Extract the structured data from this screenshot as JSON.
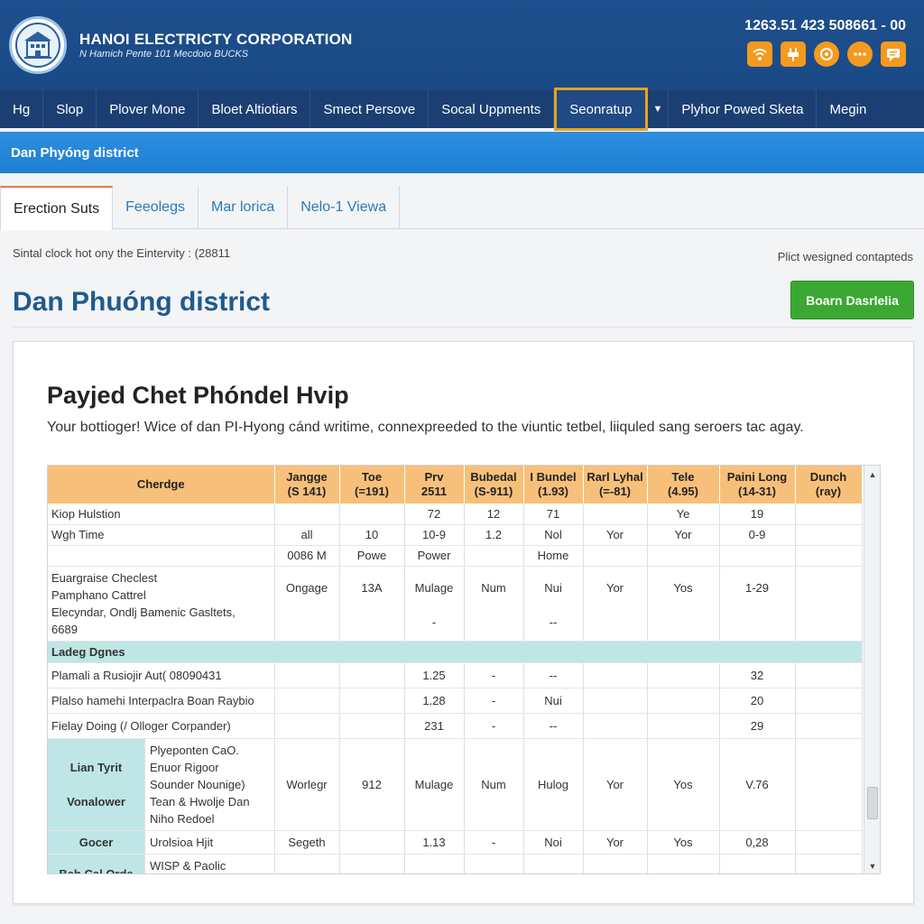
{
  "header": {
    "title": "HANOI ELECTRICTY CORPORATION",
    "subtitle": "N Hamich Pente 101 Mecdoio BUCKS",
    "phone": "1263.51 423 508661 - 00",
    "icons": [
      "wifi-icon",
      "plug-icon",
      "chat-icon",
      "more-icon",
      "message-icon"
    ]
  },
  "nav": {
    "items": [
      "Hg",
      "Slop",
      "Plover Mone",
      "Bloet Altiotiars",
      "Smect Persove",
      "Socal Uppments",
      "Seonratup",
      "Plyhor Powed Sketa",
      "Megin"
    ],
    "active_index": 6
  },
  "banner": {
    "title": "Dan Phyóng district"
  },
  "tabs": [
    "Erection Suts",
    "Feeolegs",
    "Mar lorica",
    "Nelo-1 Viewa"
  ],
  "page": {
    "subline": "Sintal clock hot ony the Eintervity : (28811",
    "subright": "Plict wesigned contapteds",
    "title": "Dan Phuóng district",
    "button_label": "Boarn Dasrlelia"
  },
  "card": {
    "title": "Payjed Chet Phóndel Hvip",
    "description": "Your bottioger! Wice of dan PI-Hyong cánd writime, connexpreeded to the viuntic tetbel, liiquled sang seroers tac agay."
  },
  "table": {
    "headers": [
      "Cherdge",
      "Jangge\n(S 141)",
      "Toe\n(=191)",
      "Prv\n2511",
      "Bubedal\n(S-911)",
      "I Bundel\n(1.93)",
      "Rarl Lyhal\n(=-81)",
      "Tele\n(4.95)",
      "Paini Long\n(14-31)",
      "Dunch\n(ray)"
    ],
    "rows1": [
      [
        "Kiop Hulstion",
        "",
        "",
        "72",
        "12",
        "71",
        "",
        "Ye",
        "19",
        ""
      ],
      [
        "Wgh Time",
        "all",
        "10",
        "10-9",
        "1.2",
        "Nol",
        "Yor",
        "Yor",
        "0-9",
        ""
      ],
      [
        "",
        "0086 M",
        "Powe",
        "Power",
        "",
        "Home",
        "",
        "",
        "",
        ""
      ]
    ],
    "multi_row": {
      "label": "Euargraise Checlest\nPamphano Cattrel\nElecyndar, Ondlj Bamenic Gasltets,\n6689",
      "cells": [
        "Ongage",
        "13A",
        "Mulage\n\n-",
        "Num",
        "Nui\n\n--",
        "Yor",
        "Yos",
        "1-29",
        ""
      ]
    },
    "section_label": "Ladeg Dgnes",
    "rows2": [
      [
        "Plamali a Rusiojir Aut( 08090431",
        "",
        "",
        "1.25",
        "-",
        "--",
        "",
        "",
        "32",
        ""
      ],
      [
        "Plalso hamehi Interpaclra Boan Raybio",
        "",
        "",
        "1.28",
        "-",
        "Nui",
        "",
        "",
        "20",
        ""
      ],
      [
        "Fielay Doing (/ Olloger Corpander)",
        "",
        "",
        "231",
        "-",
        "--",
        "",
        "",
        "29",
        ""
      ]
    ],
    "group_row": {
      "group": "Lian Tyrit\n\nVonalower",
      "label": "Plyeponten CaO.\nEnuor Rigoor\nSounder Nounige)\nTean & Hwolje Dan\nNiho Redoel",
      "cells": [
        "Worlegr",
        "912",
        "Mulage",
        "Num",
        "Hulog",
        "Yor",
        "Yos",
        "V.76",
        ""
      ]
    },
    "gocer_row": {
      "group": "Gocer",
      "label": "Urolsioa Hjit",
      "cells": [
        "Segeth",
        "",
        "1.13",
        "-",
        "Noi",
        "Yor",
        "Yos",
        "0,28",
        ""
      ]
    },
    "last_row": {
      "group": "Bah Cal Orde",
      "label": "WISP & Paolic Orapoementj"
    }
  }
}
